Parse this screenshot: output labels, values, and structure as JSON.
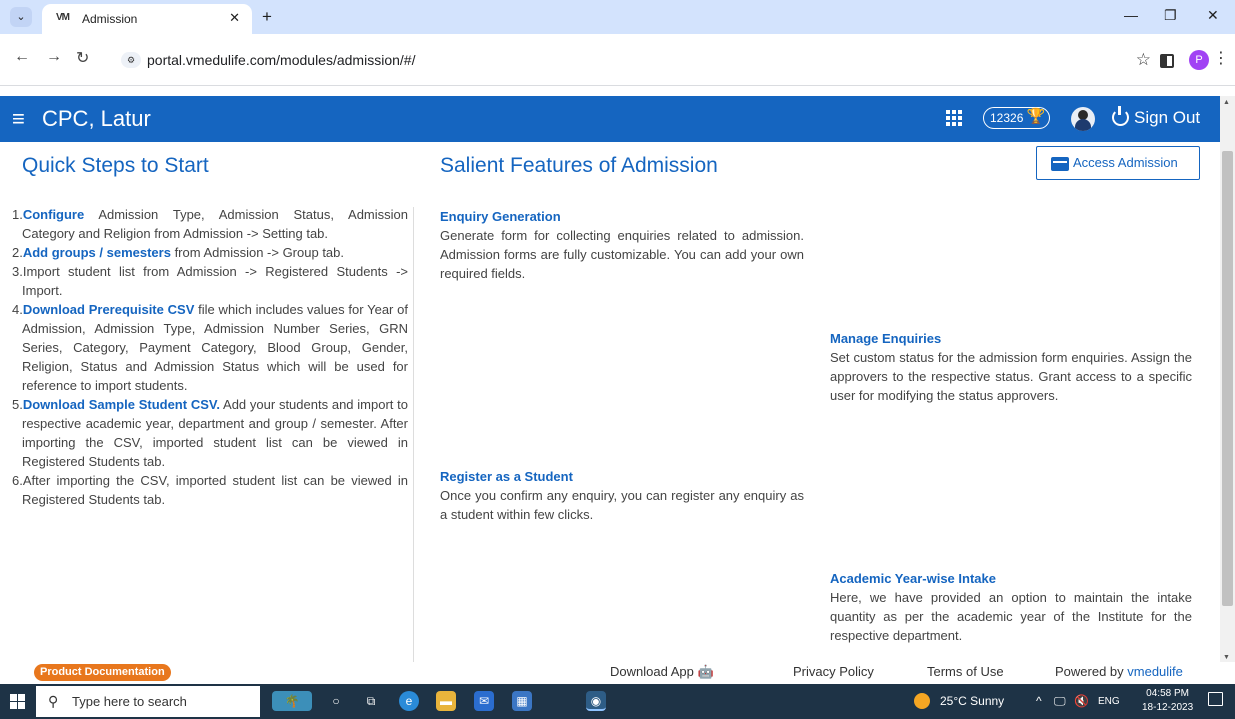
{
  "browser": {
    "tab_title": "Admission",
    "tab_favicon": "VM",
    "url": "portal.vmedulife.com/modules/admission/#/",
    "profile_initial": "P"
  },
  "header": {
    "brand": "CPC, Latur",
    "points": "12326",
    "sign_out": "Sign Out"
  },
  "quick_steps": {
    "title": "Quick Steps to Start",
    "steps": [
      {
        "num": "1.",
        "link": "Configure",
        "text": " Admission Type, Admission Status, Admission Category and Religion from Admission -> Setting tab."
      },
      {
        "num": "2.",
        "link": "Add groups / semesters",
        "text": " from Admission -> Group tab."
      },
      {
        "num": "3.",
        "link": "",
        "text": "Import student list from Admission -> Registered Students -> Import."
      },
      {
        "num": "4.",
        "link": "Download Prerequisite CSV",
        "text": " file which includes values for Year of Admission, Admission Type, Admission Number Series, GRN Series, Category, Payment Category, Blood Group, Gender, Religion, Status and Admission Status which will be used for reference to import students."
      },
      {
        "num": "5.",
        "link": "Download Sample Student CSV.",
        "text": " Add your students and import to respective academic year, department and group / semester. After importing the CSV, imported student list can be viewed in Registered Students tab."
      },
      {
        "num": "6.",
        "link": "",
        "text": "After importing the CSV, imported student list can be viewed in Registered Students tab."
      }
    ]
  },
  "features": {
    "title": "Salient Features of Admission",
    "access_button": "Access Admission",
    "items": [
      {
        "title": "Enquiry Generation",
        "text": "Generate form for collecting enquiries related to admission. Admission forms are fully customizable. You can add your own required fields."
      },
      {
        "title": "Manage Enquiries",
        "text": "Set custom status for the admission form enquiries. Assign the approvers to the respective status. Grant access to a specific user for modifying the status approvers."
      },
      {
        "title": "Register as a Student",
        "text": "Once you confirm any enquiry, you can register any enquiry as a student within few clicks."
      },
      {
        "title": "Academic Year-wise Intake",
        "text": "Here, we have provided an option to maintain the intake quantity as per the academic year of the Institute for the respective department."
      }
    ]
  },
  "footer": {
    "product_doc": "Product Documentation",
    "download_app": "Download App",
    "privacy": "Privacy Policy",
    "terms": "Terms of Use",
    "powered_prefix": "Powered by ",
    "powered_brand": "vmedulife"
  },
  "taskbar": {
    "search_placeholder": "Type here to search",
    "weather": "25°C  Sunny",
    "lang": "ENG",
    "time": "04:58 PM",
    "date": "18-12-2023"
  },
  "colors": {
    "primary": "#1565c0",
    "badge": "#e8771d",
    "taskbar": "#1e3346"
  }
}
